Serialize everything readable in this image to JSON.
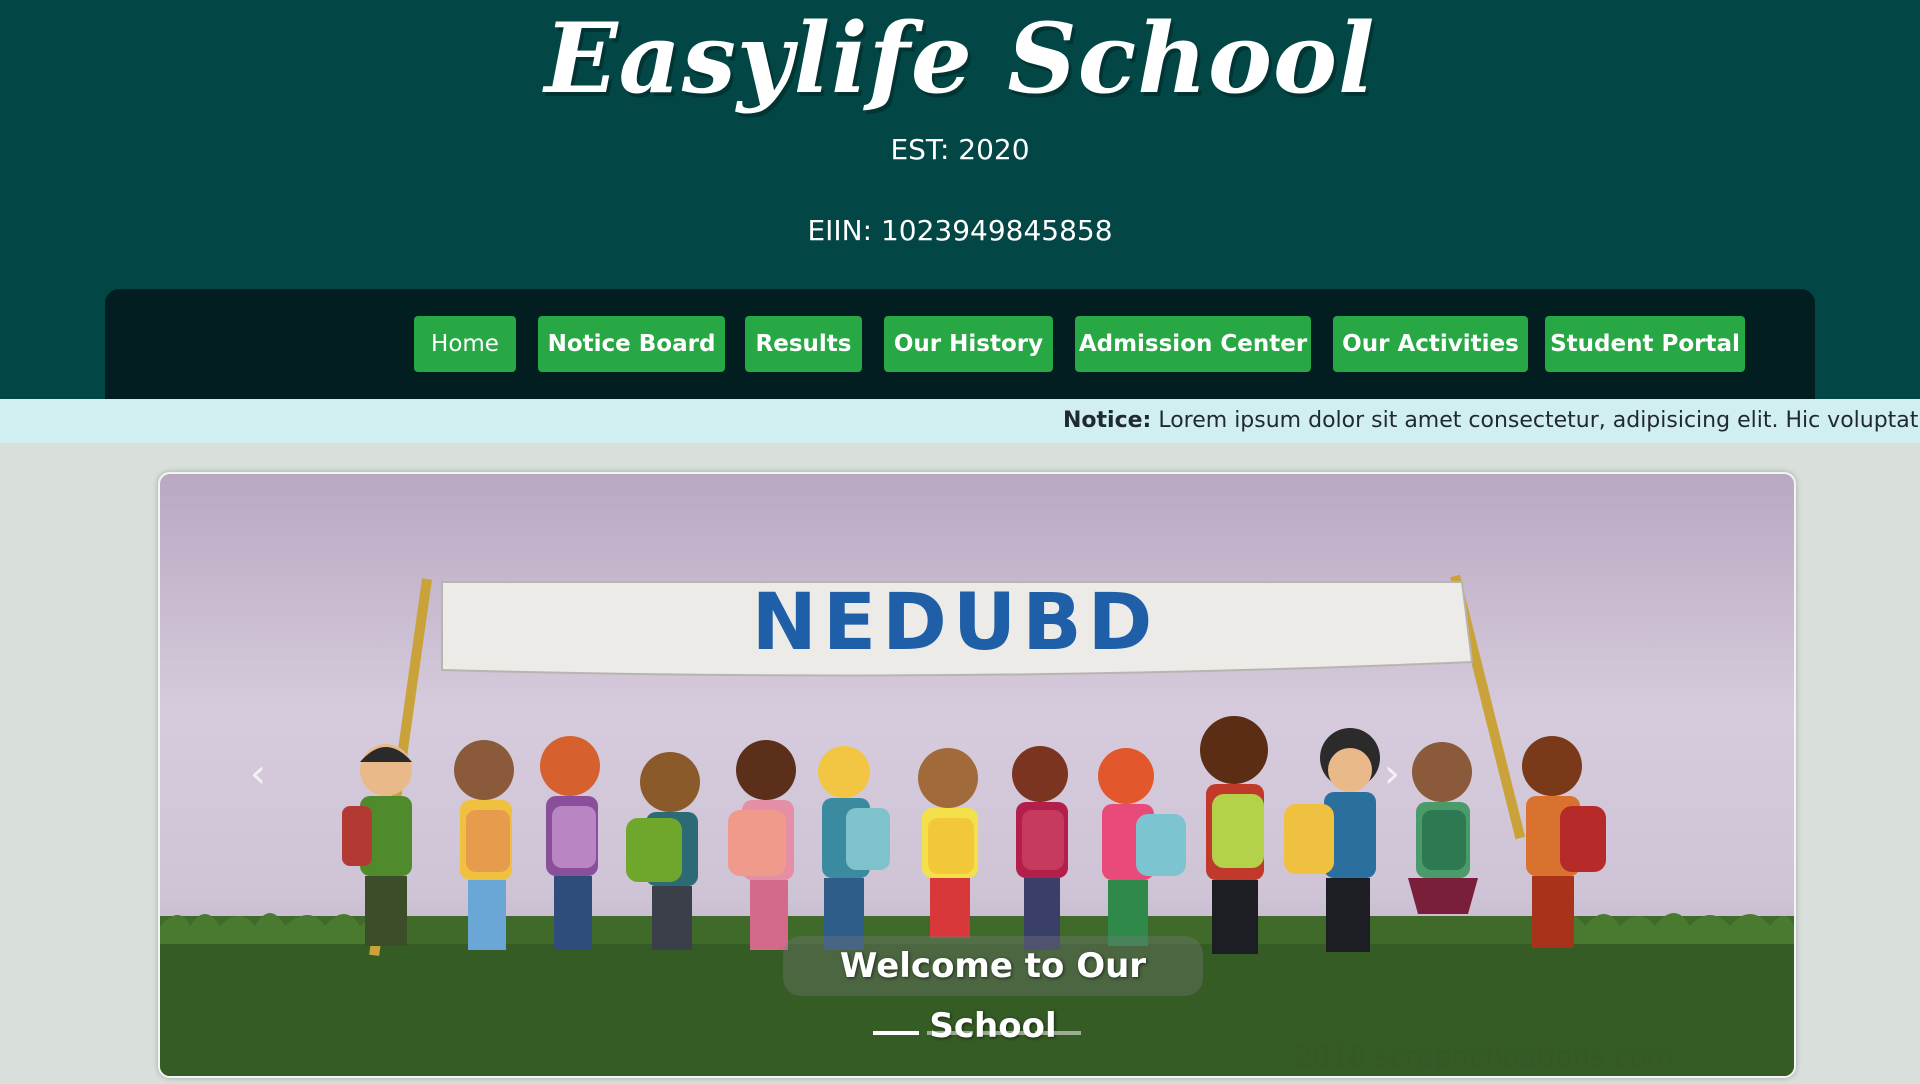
{
  "header": {
    "title": "Easylife School",
    "est": "EST: 2020",
    "eiin": "EIIN: 1023949845858"
  },
  "nav": {
    "items": [
      {
        "label": "Home"
      },
      {
        "label": "Notice Board"
      },
      {
        "label": "Results"
      },
      {
        "label": "Our History"
      },
      {
        "label": "Admission Center"
      },
      {
        "label": "Our Activities"
      },
      {
        "label": "Student Portal"
      }
    ]
  },
  "notice": {
    "label": "Notice:",
    "text": "Lorem ipsum dolor sit amet consectetur, adipisicing elit. Hic voluptatibus"
  },
  "carousel": {
    "banner_text": "NEDUBD",
    "caption": "Welcome to Our School",
    "prev_icon": "chevron-left-icon",
    "next_icon": "chevron-right-icon",
    "slide_count": 4,
    "active_slide": 1,
    "watermark": "2018 scrapnchoations.com"
  },
  "colors": {
    "header_bg": "#024645",
    "navbar_bg": "#031e20",
    "button_bg": "#28a745",
    "notice_bg": "#d1eef1",
    "page_bg": "#d9e0db"
  }
}
